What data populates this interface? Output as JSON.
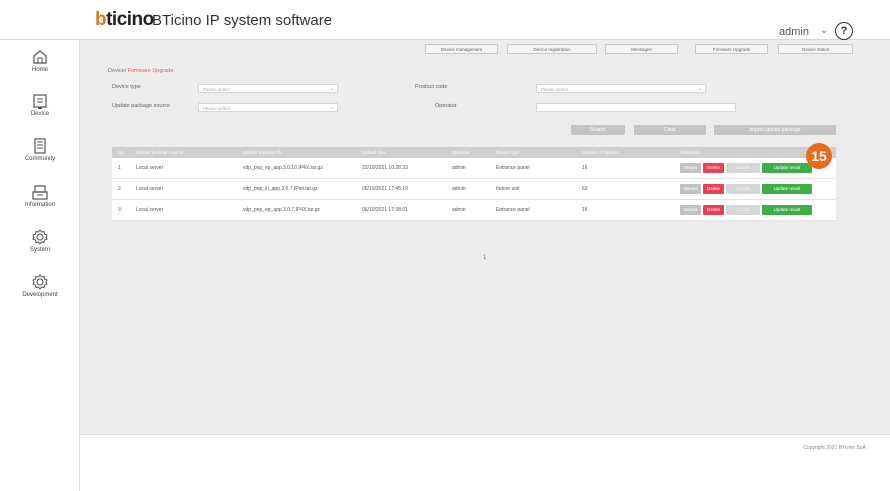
{
  "header": {
    "logo": {
      "accent": "b",
      "rest": "ticino"
    },
    "title": "BTicino IP system software",
    "user": "admin",
    "help": "?"
  },
  "sidebar": {
    "items": [
      {
        "label": "Home",
        "icon": "home-icon"
      },
      {
        "label": "Device",
        "icon": "device-icon"
      },
      {
        "label": "Community",
        "icon": "community-icon"
      },
      {
        "label": "Information",
        "icon": "information-icon"
      },
      {
        "label": "System",
        "icon": "system-gear-icon"
      },
      {
        "label": "Development",
        "icon": "development-gear-icon"
      }
    ]
  },
  "topnav": {
    "items": [
      "Device management",
      "Device registration",
      "Messages",
      "Firmware Upgrade",
      "Device status"
    ]
  },
  "breadcrumb": {
    "root": "Device",
    "separator": "/",
    "current": "Firmware Upgrade"
  },
  "filters": {
    "device_type_label": "Device type",
    "device_type_value": "Please select",
    "product_code_label": "Product code",
    "product_code_value": "Please select",
    "source_label": "Update package source",
    "source_value": "Please select",
    "operator_label": "Operator",
    "operator_value": ""
  },
  "actions": {
    "search": "Search",
    "clear": "Clear",
    "import": "Import update package"
  },
  "table": {
    "headers": [
      "No.",
      "Update package source",
      "Update package file",
      "Upload time",
      "Operator",
      "Device type",
      "Number of devices",
      "Operation"
    ],
    "rows": [
      {
        "no": "1",
        "source": "Local server",
        "file": "vdp_pnp_ep_app.3.0.10.IP4X.tar.gz",
        "time": "22/10/2021 10:28:33",
        "operator": "admin",
        "device_type": "Entrance panel",
        "count": "16"
      },
      {
        "no": "2",
        "source": "Local server",
        "file": "vdp_pnp_iu_app.3.0.7.IPint.tar.gz",
        "time": "06/10/2021 17:45:19",
        "operator": "admin",
        "device_type": "Indoor unit",
        "count": "63"
      },
      {
        "no": "3",
        "source": "Local server",
        "file": "vdp_pnp_ep_app.3.0.7.IP4X.tar.gz",
        "time": "06/10/2021 17:38:01",
        "operator": "admin",
        "device_type": "Entrance panel",
        "count": "16"
      }
    ],
    "op_buttons": {
      "details": "Details",
      "delete": "Delete",
      "update": "Update",
      "result": "Update result"
    }
  },
  "pagination": {
    "current": "1"
  },
  "badge": "15",
  "footer": {
    "copyright": "Copyright 2021 BTicino SpA"
  },
  "colors": {
    "accent_orange": "#e86a1c",
    "delete_red": "#e84054",
    "result_green": "#3fae48",
    "logo_orange": "#e07a1f"
  }
}
